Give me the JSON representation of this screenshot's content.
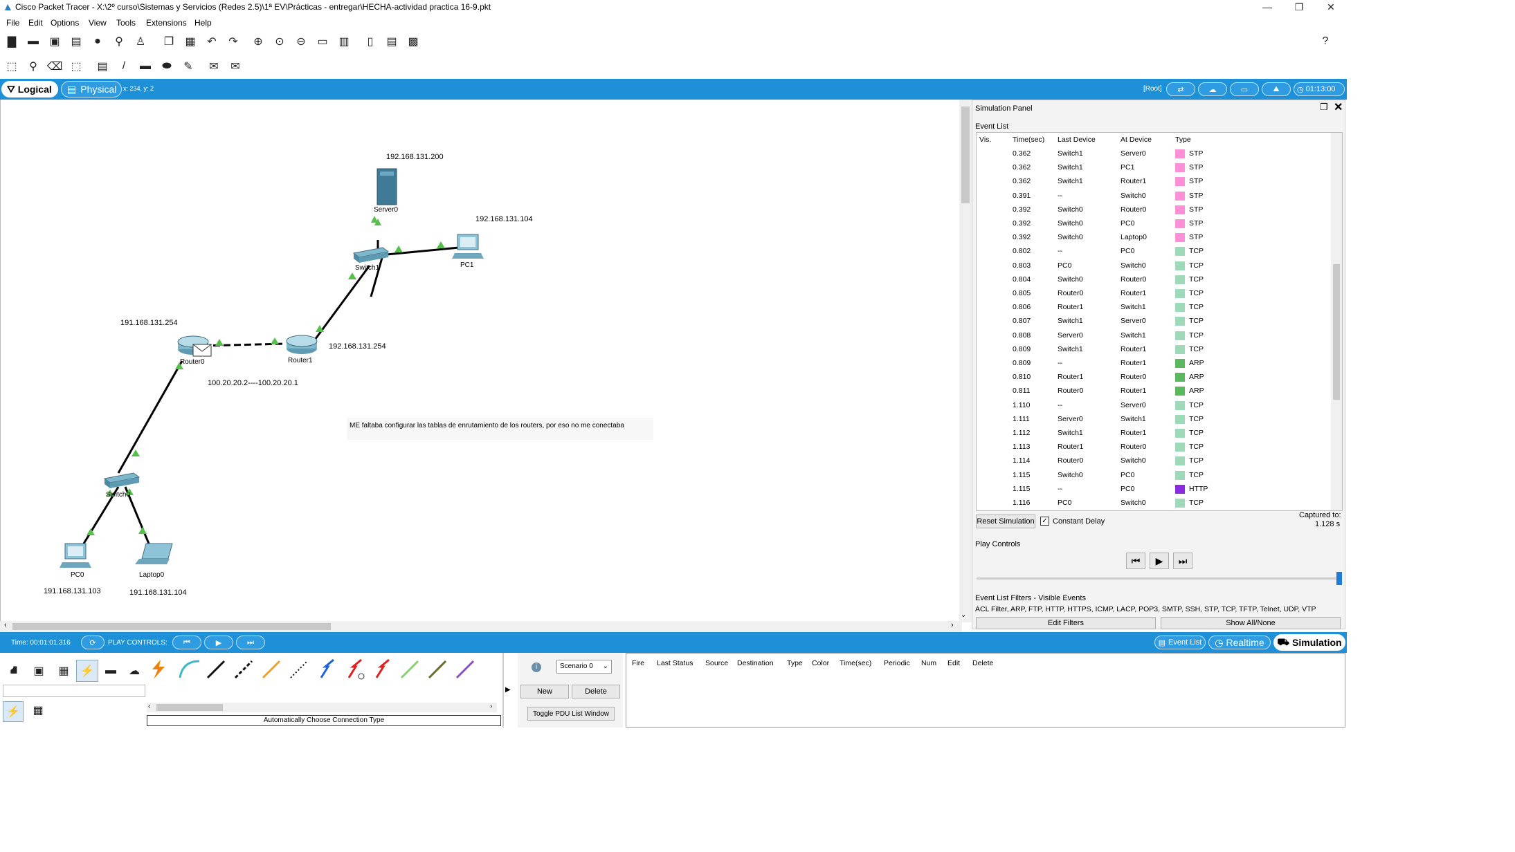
{
  "window": {
    "title": "Cisco Packet Tracer - X:\\2º curso\\Sistemas y Servicios (Redes 2.5)\\1ª EV\\Prácticas - entregar\\HECHA-actividad practica 16-9.pkt",
    "minimize": "—",
    "maximize": "❐",
    "close": "✕"
  },
  "menu": [
    "File",
    "Edit",
    "Options",
    "View",
    "Tools",
    "Extensions",
    "Help"
  ],
  "help_icon": "?",
  "modebar": {
    "logical": "Logical",
    "physical": "Physical",
    "coords": "x: 234, y: 2",
    "root": "[Root]",
    "clock": "01:13:00"
  },
  "topology": {
    "labels": {
      "server_ip": "192.168.131.200",
      "pc1_ip": "192.168.131.104",
      "router0_ip": "191.168.131.254",
      "router1_ip": "192.168.131.254",
      "serial_link": "100.20.20.2----100.20.20.1",
      "pc0_ip": "191.168.131.103",
      "laptop0_ip": "191.168.131.104",
      "note": "ME faltaba configurar las tablas de enrutamiento de los routers, por eso no me conectaba"
    },
    "devices": {
      "server0": "Server0",
      "pc1": "PC1",
      "switch1": "Switch1",
      "router0": "Router0",
      "router1": "Router1",
      "switch0": "Switch0",
      "pc0": "PC0",
      "laptop0": "Laptop0"
    }
  },
  "simulation": {
    "title": "Simulation Panel",
    "event_list_label": "Event List",
    "columns": [
      "Vis.",
      "Time(sec)",
      "Last Device",
      "At Device",
      "Type"
    ],
    "events": [
      {
        "time": "0.362",
        "last": "Switch1",
        "at": "Server0",
        "type": "STP",
        "color": "#ff8fd6"
      },
      {
        "time": "0.362",
        "last": "Switch1",
        "at": "PC1",
        "type": "STP",
        "color": "#ff8fd6"
      },
      {
        "time": "0.362",
        "last": "Switch1",
        "at": "Router1",
        "type": "STP",
        "color": "#ff8fd6"
      },
      {
        "time": "0.391",
        "last": "--",
        "at": "Switch0",
        "type": "STP",
        "color": "#ff8fd6"
      },
      {
        "time": "0.392",
        "last": "Switch0",
        "at": "Router0",
        "type": "STP",
        "color": "#ff8fd6"
      },
      {
        "time": "0.392",
        "last": "Switch0",
        "at": "PC0",
        "type": "STP",
        "color": "#ff8fd6"
      },
      {
        "time": "0.392",
        "last": "Switch0",
        "at": "Laptop0",
        "type": "STP",
        "color": "#ff8fd6"
      },
      {
        "time": "0.802",
        "last": "--",
        "at": "PC0",
        "type": "TCP",
        "color": "#9ed9b9"
      },
      {
        "time": "0.803",
        "last": "PC0",
        "at": "Switch0",
        "type": "TCP",
        "color": "#9ed9b9"
      },
      {
        "time": "0.804",
        "last": "Switch0",
        "at": "Router0",
        "type": "TCP",
        "color": "#9ed9b9"
      },
      {
        "time": "0.805",
        "last": "Router0",
        "at": "Router1",
        "type": "TCP",
        "color": "#9ed9b9"
      },
      {
        "time": "0.806",
        "last": "Router1",
        "at": "Switch1",
        "type": "TCP",
        "color": "#9ed9b9"
      },
      {
        "time": "0.807",
        "last": "Switch1",
        "at": "Server0",
        "type": "TCP",
        "color": "#9ed9b9"
      },
      {
        "time": "0.808",
        "last": "Server0",
        "at": "Switch1",
        "type": "TCP",
        "color": "#9ed9b9"
      },
      {
        "time": "0.809",
        "last": "Switch1",
        "at": "Router1",
        "type": "TCP",
        "color": "#9ed9b9"
      },
      {
        "time": "0.809",
        "last": "--",
        "at": "Router1",
        "type": "ARP",
        "color": "#5cb85c"
      },
      {
        "time": "0.810",
        "last": "Router1",
        "at": "Router0",
        "type": "ARP",
        "color": "#5cb85c"
      },
      {
        "time": "0.811",
        "last": "Router0",
        "at": "Router1",
        "type": "ARP",
        "color": "#5cb85c"
      },
      {
        "time": "1.110",
        "last": "--",
        "at": "Server0",
        "type": "TCP",
        "color": "#9ed9b9"
      },
      {
        "time": "1.111",
        "last": "Server0",
        "at": "Switch1",
        "type": "TCP",
        "color": "#9ed9b9"
      },
      {
        "time": "1.112",
        "last": "Switch1",
        "at": "Router1",
        "type": "TCP",
        "color": "#9ed9b9"
      },
      {
        "time": "1.113",
        "last": "Router1",
        "at": "Router0",
        "type": "TCP",
        "color": "#9ed9b9"
      },
      {
        "time": "1.114",
        "last": "Router0",
        "at": "Switch0",
        "type": "TCP",
        "color": "#9ed9b9"
      },
      {
        "time": "1.115",
        "last": "Switch0",
        "at": "PC0",
        "type": "TCP",
        "color": "#9ed9b9"
      },
      {
        "time": "1.115",
        "last": "--",
        "at": "PC0",
        "type": "HTTP",
        "color": "#8a2be2"
      },
      {
        "time": "1.116",
        "last": "PC0",
        "at": "Switch0",
        "type": "TCP",
        "color": "#9ed9b9"
      }
    ],
    "reset_button": "Reset Simulation",
    "constant_delay": "Constant Delay",
    "captured_label": "Captured to:",
    "captured_value": "1.128 s",
    "play_controls": "Play Controls",
    "filters_title": "Event List Filters - Visible Events",
    "filters_list": "ACL Filter, ARP, FTP, HTTP, HTTPS, ICMP, LACP, POP3, SMTP, SSH, STP, TCP, TFTP, Telnet, UDP, VTP",
    "edit_filters": "Edit Filters",
    "show_all": "Show All/None"
  },
  "bottom": {
    "time": "Time: 00:01:01.316",
    "play_controls": "PLAY CONTROLS:",
    "event_list": "Event List",
    "realtime": "Realtime",
    "simulation": "Simulation",
    "connection_type": "Automatically Choose Connection Type",
    "scenario": "Scenario 0",
    "new_button": "New",
    "delete_button": "Delete",
    "toggle_pdu": "Toggle PDU List Window",
    "pdu_columns": [
      "Fire",
      "Last Status",
      "Source",
      "Destination",
      "Type",
      "Color",
      "Time(sec)",
      "Periodic",
      "Num",
      "Edit",
      "Delete"
    ]
  }
}
